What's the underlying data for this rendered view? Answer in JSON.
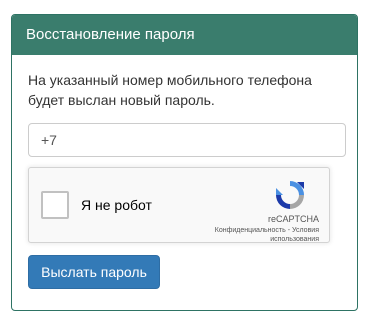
{
  "panel": {
    "title": "Восстановление пароля",
    "header_color": "#3a7d6d"
  },
  "form": {
    "intro_text": "На указанный номер мобильного телефона будет выслан новый пароль.",
    "phone_value": "+7",
    "submit_label": "Выслать пароль",
    "submit_color": "#337ab7"
  },
  "recaptcha": {
    "checkbox_label": "Я не робот",
    "brand": "reCAPTCHA",
    "privacy_link": "Конфиденциальность",
    "separator": " - ",
    "terms_link": "Условия использования",
    "logo_icon": "recaptcha-logo-icon",
    "checked": false
  }
}
